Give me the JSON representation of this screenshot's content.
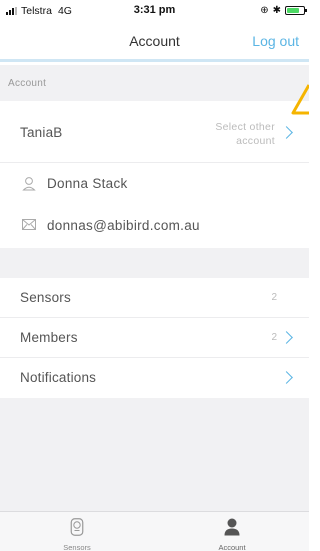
{
  "status_bar": {
    "carrier": "Telstra",
    "network": "4G",
    "time": "3:31 pm"
  },
  "nav": {
    "title": "Account",
    "logout_label": "Log out"
  },
  "account_section": {
    "header": "Account",
    "username": "TaniaB",
    "select_other_line1": "Select other",
    "select_other_line2": "account",
    "full_name": "Donna Stack",
    "email": "donnas@abibird.com.au"
  },
  "menu": {
    "items": [
      {
        "label": "Sensors",
        "count": "2",
        "chevron": false
      },
      {
        "label": "Members",
        "count": "2",
        "chevron": true
      },
      {
        "label": "Notifications",
        "count": "",
        "chevron": true
      }
    ]
  },
  "tab_bar": {
    "tabs": [
      {
        "label": "Sensors",
        "icon": "sensor-icon",
        "active": false
      },
      {
        "label": "Account",
        "icon": "person-icon",
        "active": true
      }
    ]
  },
  "colors": {
    "accent": "#5bb5e4",
    "background_gray": "#f1f1f3",
    "warning": "#f5b400"
  }
}
